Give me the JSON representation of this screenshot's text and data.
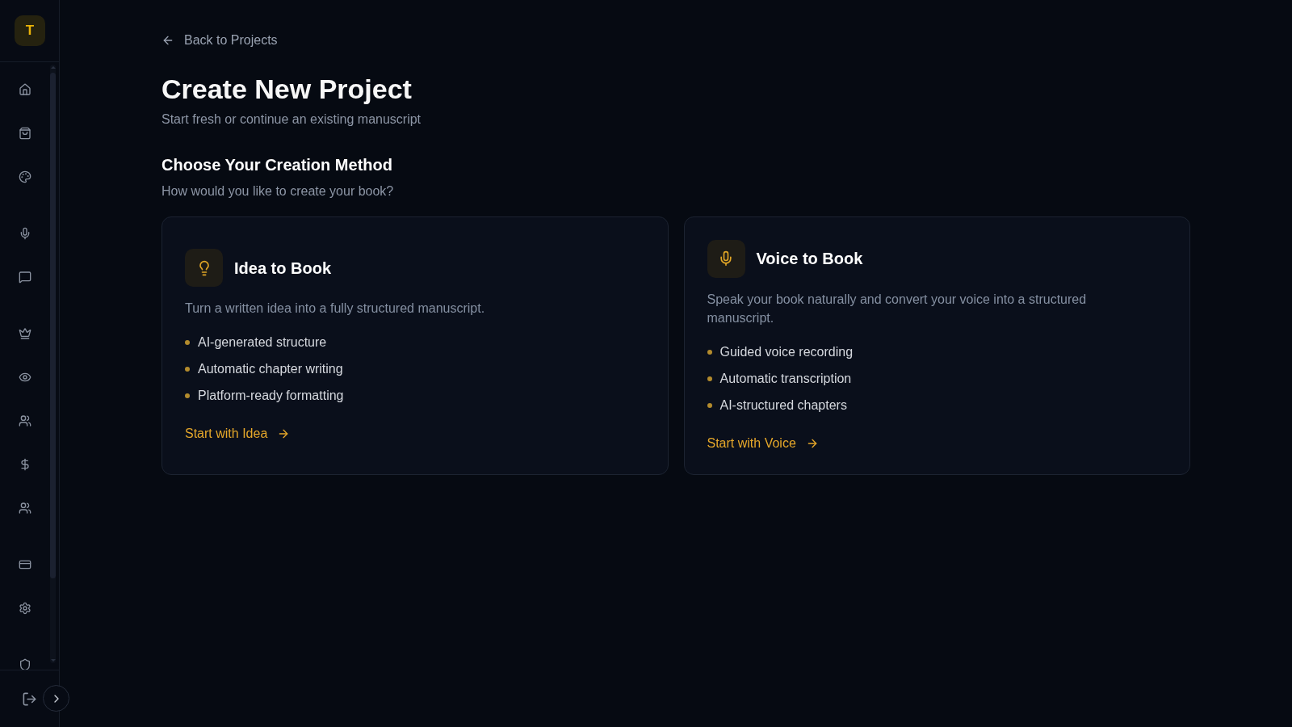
{
  "sidebar": {
    "logo": "T"
  },
  "back_link": "Back to Projects",
  "header": {
    "title": "Create New Project",
    "subtitle": "Start fresh or continue an existing manuscript"
  },
  "section": {
    "title": "Choose Your Creation Method",
    "subtitle": "How would you like to create your book?"
  },
  "cards": [
    {
      "kind": "idea",
      "title": "Idea to Book",
      "description": "Turn a written idea into a fully structured manuscript.",
      "features": [
        "AI-generated structure",
        "Automatic chapter writing",
        "Platform-ready formatting"
      ],
      "action": "Start with Idea"
    },
    {
      "kind": "voice",
      "title": "Voice to Book",
      "description": "Speak your book naturally and convert your voice into a structured manuscript.",
      "features": [
        "Guided voice recording",
        "Automatic transcription",
        "AI-structured chapters"
      ],
      "action": "Start with Voice"
    }
  ]
}
